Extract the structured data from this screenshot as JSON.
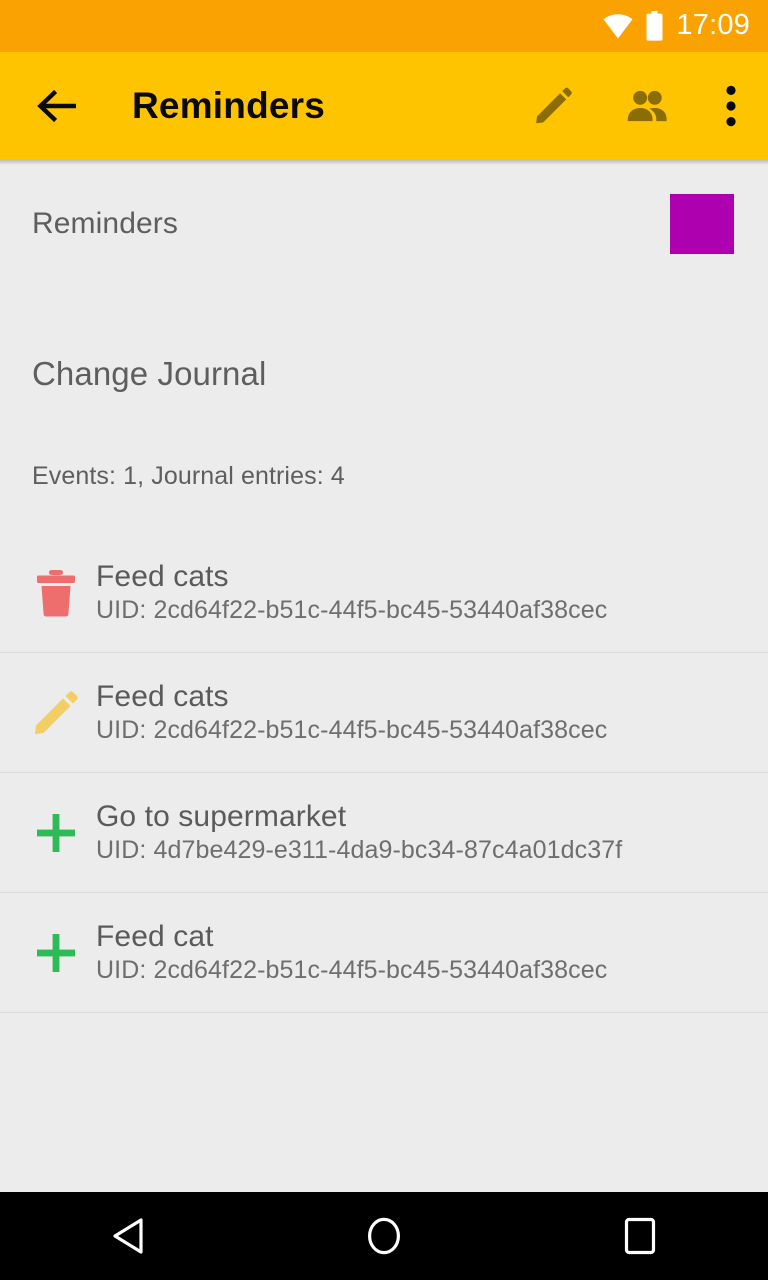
{
  "status_bar": {
    "time": "17:09",
    "icons": [
      "wifi-icon",
      "battery-icon"
    ]
  },
  "app_bar": {
    "back_icon": "back-arrow-icon",
    "title": "Reminders",
    "actions": [
      {
        "name": "edit-icon",
        "label": "Edit"
      },
      {
        "name": "people-icon",
        "label": "Attendees"
      },
      {
        "name": "overflow-menu-icon",
        "label": "More options"
      }
    ]
  },
  "calendar": {
    "name": "Reminders",
    "color": "#AF00AF"
  },
  "journal": {
    "section_title": "Change Journal",
    "stats": "Events: 1, Journal entries: 4",
    "entries": [
      {
        "action_icon": "delete-icon",
        "action_color": "#EE6E6E",
        "title": "Feed cats",
        "uid": "UID: 2cd64f22-b51c-44f5-bc45-53440af38cec"
      },
      {
        "action_icon": "edit-pencil-icon",
        "action_color": "#F2CE63",
        "title": "Feed cats",
        "uid": "UID: 2cd64f22-b51c-44f5-bc45-53440af38cec"
      },
      {
        "action_icon": "add-plus-icon",
        "action_color": "#2DBA57",
        "title": "Go to supermarket",
        "uid": "UID: 4d7be429-e311-4da9-bc34-87c4a01dc37f"
      },
      {
        "action_icon": "add-plus-icon",
        "action_color": "#2DBA57",
        "title": "Feed cat",
        "uid": "UID: 2cd64f22-b51c-44f5-bc45-53440af38cec"
      }
    ]
  },
  "nav_bar": {
    "back_label": "Back",
    "home_label": "Home",
    "recents_label": "Recents"
  },
  "colors": {
    "status_bar": "#F9A201",
    "app_bar": "#FFC400",
    "background": "#ECECEC",
    "accent_purple": "#AF00AF",
    "text_primary": "#5A5A5A",
    "text_secondary": "#6E6E6E",
    "toolbar_icon": "#8A6D05",
    "divider": "#DBDBDB"
  }
}
